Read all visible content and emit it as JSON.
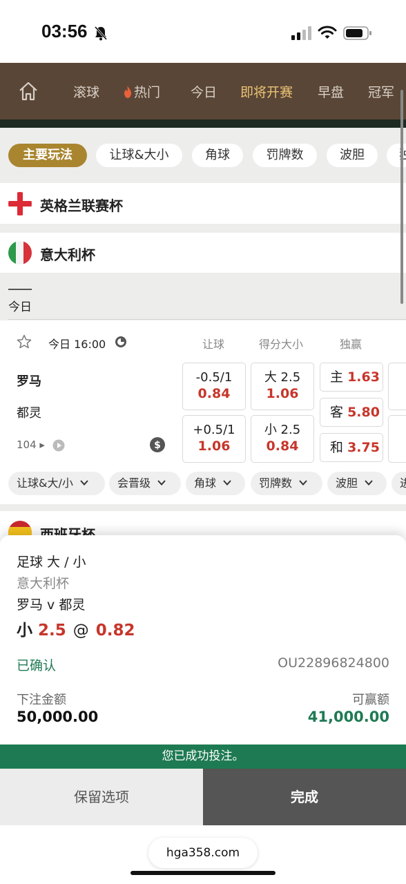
{
  "status_bar": {
    "time": "03:56",
    "icons": [
      "bell-slash-icon",
      "signal-icon",
      "wifi-icon",
      "battery-icon"
    ]
  },
  "nav": {
    "home_icon": "home-icon",
    "items": [
      {
        "label": "滚球",
        "icon": ""
      },
      {
        "label": "热门",
        "icon": "fire-icon"
      },
      {
        "label": "今日",
        "icon": ""
      },
      {
        "label": "即将开赛",
        "icon": "",
        "active": true
      },
      {
        "label": "早盘",
        "icon": ""
      },
      {
        "label": "冠军",
        "icon": ""
      }
    ]
  },
  "filters": [
    "主要玩法",
    "让球&大小",
    "角球",
    "罚牌数",
    "波胆",
    "独"
  ],
  "leagues": [
    {
      "name": "英格兰联赛杯",
      "flag": "england-flag"
    },
    {
      "name": "意大利杯",
      "flag": "italy-flag"
    }
  ],
  "day_tab": "今日",
  "match": {
    "time": "今日 16:00",
    "headers": {
      "handicap": "让球",
      "total": "得分大小",
      "moneyline": "独赢"
    },
    "home": "罗马",
    "away": "都灵",
    "more_count": "104",
    "handicap": [
      {
        "line": "-0.5/1",
        "odd": "0.84"
      },
      {
        "line": "+0.5/1",
        "odd": "1.06"
      }
    ],
    "total": [
      {
        "line": "大 2.5",
        "odd": "1.06"
      },
      {
        "line": "小 2.5",
        "odd": "0.84"
      }
    ],
    "moneyline": [
      {
        "label": "主",
        "odd": "1.63"
      },
      {
        "label": "客",
        "odd": "5.80"
      },
      {
        "label": "和",
        "odd": "3.75"
      }
    ],
    "chips": [
      "让球&大/小",
      "会晋级",
      "角球",
      "罚牌数",
      "波胆",
      "进"
    ]
  },
  "next_league": {
    "name": "西班牙杯",
    "flag": "spain-flag"
  },
  "bet_slip": {
    "market": "足球 大 / 小",
    "league": "意大利杯",
    "fixture": "罗马 v 都灵",
    "selection": "小",
    "line": "2.5",
    "at": "@",
    "odds": "0.82",
    "status": "已确认",
    "ticket_id": "OU22896824800",
    "stake_label": "下注金额",
    "stake": "50,000.00",
    "win_label": "可赢额",
    "win": "41,000.00"
  },
  "success_message": "您已成功投注。",
  "buttons": {
    "keep": "保留选项",
    "done": "完成"
  },
  "browser": {
    "url": "hga358.com"
  },
  "colors": {
    "nav_bg": "#5a4637",
    "gold": "#a9852f",
    "odds_red": "#c7362b",
    "success_green": "#1e7a52"
  }
}
